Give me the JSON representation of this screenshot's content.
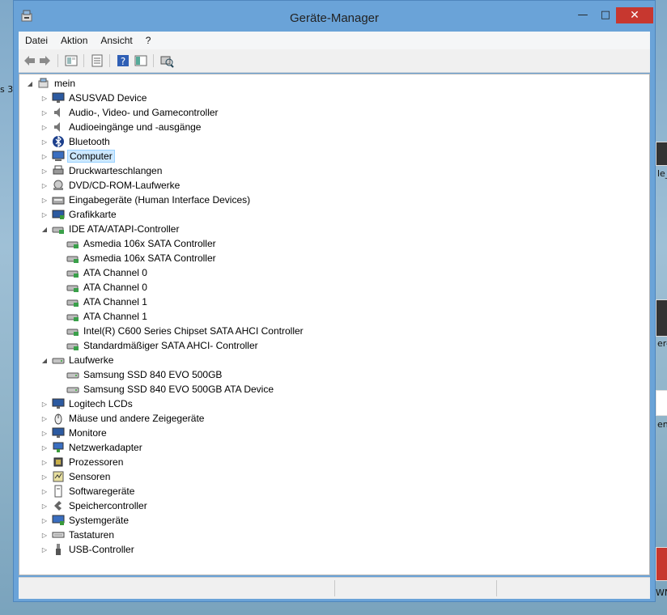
{
  "window": {
    "title": "Geräte-Manager"
  },
  "desktop": {
    "frag1": "s 3",
    "frag2": "le_",
    "frag3": "er-",
    "frag4": "en",
    "frag5": "WN"
  },
  "menu": [
    "Datei",
    "Aktion",
    "Ansicht",
    "?"
  ],
  "toolbar": [
    "back-icon",
    "forward-icon",
    "up-level-icon",
    "properties-icon",
    "help-icon",
    "view-icon",
    "scan-hardware-icon"
  ],
  "tree": {
    "root": "mein",
    "items": [
      {
        "label": "ASUSVAD Device",
        "icon": "monitor-icon",
        "state": "collapsed",
        "depth": 1
      },
      {
        "label": "Audio-, Video- und Gamecontroller",
        "icon": "speaker-icon",
        "state": "collapsed",
        "depth": 1
      },
      {
        "label": "Audioeingänge und -ausgänge",
        "icon": "speaker-icon",
        "state": "collapsed",
        "depth": 1
      },
      {
        "label": "Bluetooth",
        "icon": "bluetooth-icon",
        "state": "collapsed",
        "depth": 1
      },
      {
        "label": "Computer",
        "icon": "computer-icon",
        "state": "collapsed",
        "depth": 1,
        "selected": true
      },
      {
        "label": "Druckwarteschlangen",
        "icon": "printer-icon",
        "state": "collapsed",
        "depth": 1
      },
      {
        "label": "DVD/CD-ROM-Laufwerke",
        "icon": "disc-drive-icon",
        "state": "collapsed",
        "depth": 1
      },
      {
        "label": "Eingabegeräte (Human Interface Devices)",
        "icon": "hid-icon",
        "state": "collapsed",
        "depth": 1
      },
      {
        "label": "Grafikkarte",
        "icon": "display-adapter-icon",
        "state": "collapsed",
        "depth": 1
      },
      {
        "label": "IDE ATA/ATAPI-Controller",
        "icon": "ide-controller-icon",
        "state": "expanded",
        "depth": 1
      },
      {
        "label": "Asmedia 106x SATA Controller",
        "icon": "ide-controller-icon",
        "state": "leaf",
        "depth": 2
      },
      {
        "label": "Asmedia 106x SATA Controller",
        "icon": "ide-controller-icon",
        "state": "leaf",
        "depth": 2
      },
      {
        "label": "ATA Channel 0",
        "icon": "ide-controller-icon",
        "state": "leaf",
        "depth": 2
      },
      {
        "label": "ATA Channel 0",
        "icon": "ide-controller-icon",
        "state": "leaf",
        "depth": 2
      },
      {
        "label": "ATA Channel 1",
        "icon": "ide-controller-icon",
        "state": "leaf",
        "depth": 2
      },
      {
        "label": "ATA Channel 1",
        "icon": "ide-controller-icon",
        "state": "leaf",
        "depth": 2
      },
      {
        "label": "Intel(R) C600 Series Chipset SATA AHCI Controller",
        "icon": "ide-controller-icon",
        "state": "leaf",
        "depth": 2
      },
      {
        "label": "Standardmäßiger SATA AHCI- Controller",
        "icon": "ide-controller-icon",
        "state": "leaf",
        "depth": 2
      },
      {
        "label": "Laufwerke",
        "icon": "disk-drive-icon",
        "state": "expanded",
        "depth": 1
      },
      {
        "label": "Samsung SSD 840 EVO 500GB",
        "icon": "disk-drive-icon",
        "state": "leaf",
        "depth": 2
      },
      {
        "label": "Samsung SSD 840 EVO 500GB ATA Device",
        "icon": "disk-drive-icon",
        "state": "leaf",
        "depth": 2
      },
      {
        "label": "Logitech LCDs",
        "icon": "monitor-icon",
        "state": "collapsed",
        "depth": 1
      },
      {
        "label": "Mäuse und andere Zeigegeräte",
        "icon": "mouse-icon",
        "state": "collapsed",
        "depth": 1
      },
      {
        "label": "Monitore",
        "icon": "monitor-icon",
        "state": "collapsed",
        "depth": 1
      },
      {
        "label": "Netzwerkadapter",
        "icon": "network-adapter-icon",
        "state": "collapsed",
        "depth": 1
      },
      {
        "label": "Prozessoren",
        "icon": "processor-icon",
        "state": "collapsed",
        "depth": 1
      },
      {
        "label": "Sensoren",
        "icon": "sensor-icon",
        "state": "collapsed",
        "depth": 1
      },
      {
        "label": "Softwaregeräte",
        "icon": "software-device-icon",
        "state": "collapsed",
        "depth": 1
      },
      {
        "label": "Speichercontroller",
        "icon": "storage-controller-icon",
        "state": "collapsed",
        "depth": 1
      },
      {
        "label": "Systemgeräte",
        "icon": "system-device-icon",
        "state": "collapsed",
        "depth": 1
      },
      {
        "label": "Tastaturen",
        "icon": "keyboard-icon",
        "state": "collapsed",
        "depth": 1
      },
      {
        "label": "USB-Controller",
        "icon": "usb-icon",
        "state": "collapsed",
        "depth": 1
      }
    ]
  },
  "colors": {
    "titlebar": "#6aa3d8",
    "close": "#c7372f",
    "selection": "#cce8ff",
    "selection_border": "#99d1ff"
  }
}
